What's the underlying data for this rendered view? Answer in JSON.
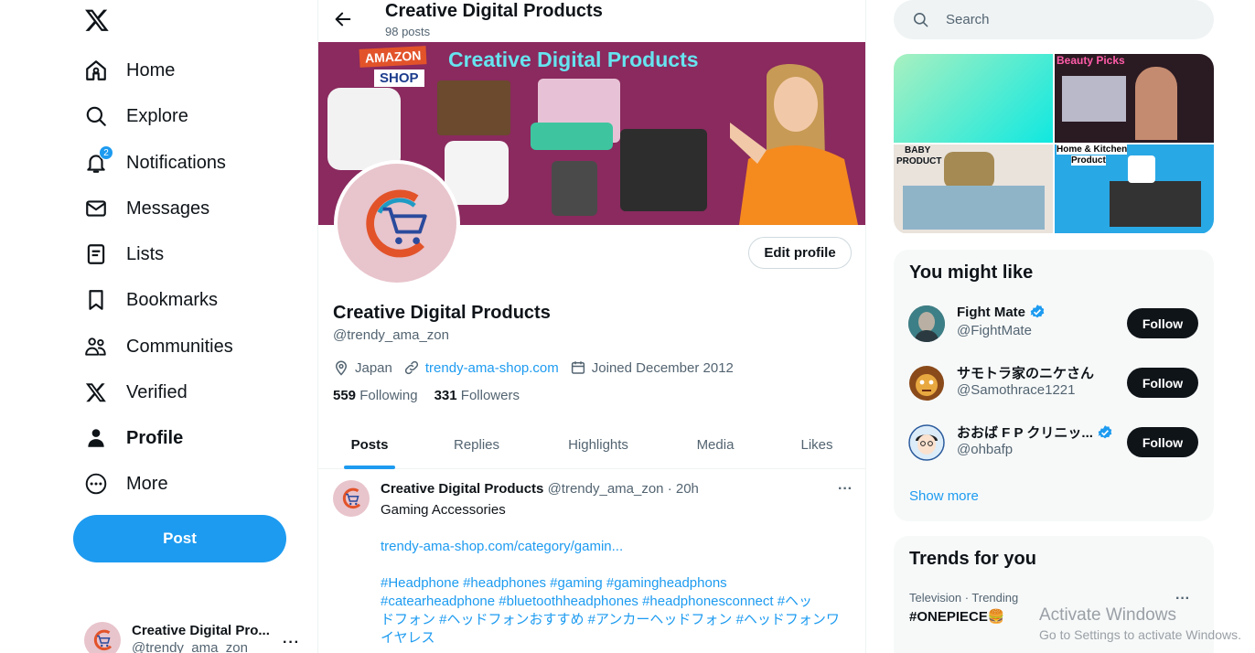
{
  "nav": {
    "items": [
      {
        "label": "Home",
        "icon": "home-icon"
      },
      {
        "label": "Explore",
        "icon": "search-icon"
      },
      {
        "label": "Notifications",
        "icon": "bell-icon",
        "badge": "2"
      },
      {
        "label": "Messages",
        "icon": "mail-icon"
      },
      {
        "label": "Lists",
        "icon": "list-icon"
      },
      {
        "label": "Bookmarks",
        "icon": "bookmark-icon"
      },
      {
        "label": "Communities",
        "icon": "communities-icon"
      },
      {
        "label": "Verified",
        "icon": "x-logo-icon"
      },
      {
        "label": "Profile",
        "icon": "person-icon"
      },
      {
        "label": "More",
        "icon": "more-circle-icon"
      }
    ],
    "post_label": "Post",
    "account": {
      "name": "Creative Digital Pro...",
      "handle": "@trendy_ama_zon"
    }
  },
  "header": {
    "title": "Creative Digital Products",
    "post_count": "98 posts"
  },
  "banner": {
    "badge_top": "AMAZON",
    "badge_bottom": "SHOP",
    "title": "Creative Digital Products"
  },
  "profile": {
    "edit_label": "Edit profile",
    "name": "Creative Digital Products",
    "handle": "@trendy_ama_zon",
    "location": "Japan",
    "website": "trendy-ama-shop.com",
    "joined": "Joined December 2012",
    "following_count": "559",
    "following_label": "Following",
    "followers_count": "331",
    "followers_label": "Followers"
  },
  "tabs": [
    {
      "label": "Posts",
      "active": true
    },
    {
      "label": "Replies"
    },
    {
      "label": "Highlights"
    },
    {
      "label": "Media"
    },
    {
      "label": "Likes"
    }
  ],
  "tweet": {
    "name": "Creative Digital Products",
    "handle_time": "@trendy_ama_zon · 20h",
    "text": "Gaming Accessories",
    "link": "trendy-ama-shop.com/category/gamin...",
    "hashtags_line1": "#Headphone #headphones #gaming #gamingheadphons",
    "hashtags_line2": "#catearheadphone #bluetoothheadphones #headphonesconnect #ヘッ",
    "hashtags_line3": "ドフォン #ヘッドフォンおすすめ #アンカーヘッドフォン #ヘッドフォンワ",
    "hashtags_line4": "イヤレス"
  },
  "search": {
    "placeholder": "Search"
  },
  "media_grid": {
    "caption_tr": "Beauty Picks",
    "caption_bl_1": "BABY",
    "caption_bl_2": "PRODUCT",
    "caption_br_1": "Home & Kitchen",
    "caption_br_2": "Product"
  },
  "who_to_follow": {
    "title": "You might like",
    "users": [
      {
        "name": "Fight Mate",
        "handle": "@FightMate",
        "verified": true
      },
      {
        "name": "サモトラ家のニケさん",
        "handle": "@Samothrace1221",
        "verified": false
      },
      {
        "name": "おおば F P クリニッ...",
        "handle": "@ohbafp",
        "verified": true
      }
    ],
    "follow_label": "Follow",
    "show_more": "Show more"
  },
  "trends": {
    "title": "Trends for you",
    "category": "Television · Trending",
    "name": "#ONEPIECE🍔"
  },
  "watermark": {
    "line1": "Activate Windows",
    "line2": "Go to Settings to activate Windows."
  },
  "colors": {
    "accent": "#1d9bf0",
    "text": "#0f1419",
    "muted": "#536471",
    "banner": "#8a2a5e"
  }
}
